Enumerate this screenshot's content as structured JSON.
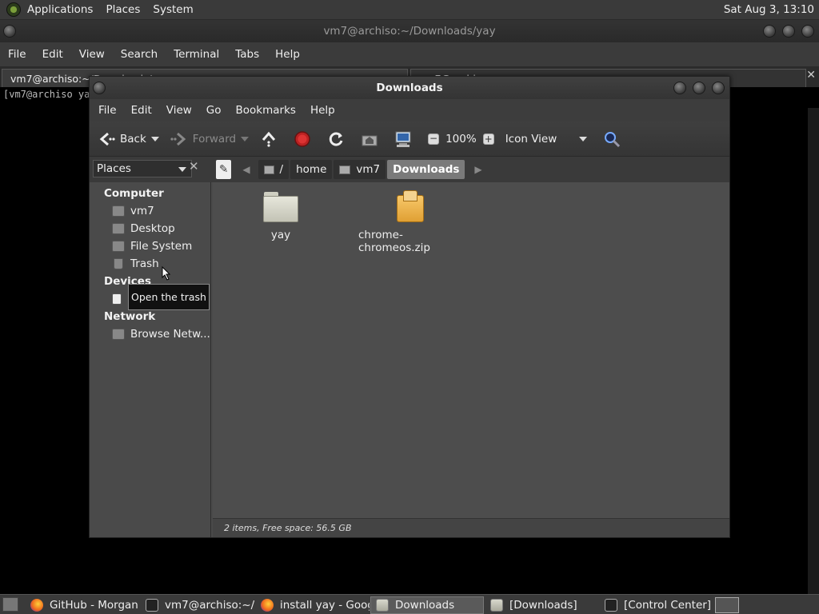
{
  "top_panel": {
    "menus": [
      "Applications",
      "Places",
      "System"
    ],
    "clock": "Sat Aug  3, 13:10"
  },
  "terminal": {
    "title": "vm7@archiso:~/Downloads/yay",
    "menu": [
      "File",
      "Edit",
      "View",
      "Search",
      "Terminal",
      "Tabs",
      "Help"
    ],
    "tab1": "vm7@archiso:~/Downloads/yay",
    "tab2": "vm7@archiso",
    "prompt": "[vm7@archiso yay]$"
  },
  "file_manager": {
    "title": "Downloads",
    "menu": [
      "File",
      "Edit",
      "View",
      "Go",
      "Bookmarks",
      "Help"
    ],
    "toolbar": {
      "back": "Back",
      "forward": "Forward",
      "zoom": "100%",
      "view_mode": "Icon View"
    },
    "places_label": "Places",
    "path": {
      "root": "/",
      "home": "home",
      "user": "vm7",
      "current": "Downloads"
    },
    "sidebar": {
      "computer_head": "Computer",
      "computer_items": [
        "vm7",
        "Desktop",
        "File System",
        "Trash"
      ],
      "devices_head": "Devices",
      "network_head": "Network",
      "network_items": [
        "Browse Netw..."
      ]
    },
    "files": [
      {
        "name": "yay",
        "kind": "folder"
      },
      {
        "name": "chrome-chromeos.zip",
        "kind": "zip"
      }
    ],
    "status": "2 items, Free space: 56.5 GB",
    "tooltip": "Open the trash"
  },
  "taskbar": {
    "tasks": [
      {
        "label": "GitHub - Morgan...",
        "icon": "firefox-icon"
      },
      {
        "label": "vm7@archiso:~/...",
        "icon": "terminal-icon"
      },
      {
        "label": "install yay - Googl...",
        "icon": "firefox-icon"
      },
      {
        "label": "Downloads",
        "icon": "folder-icon"
      },
      {
        "label": "[Downloads]",
        "icon": "folder-icon"
      },
      {
        "label": "[Control Center]",
        "icon": "control-center-icon"
      }
    ]
  }
}
